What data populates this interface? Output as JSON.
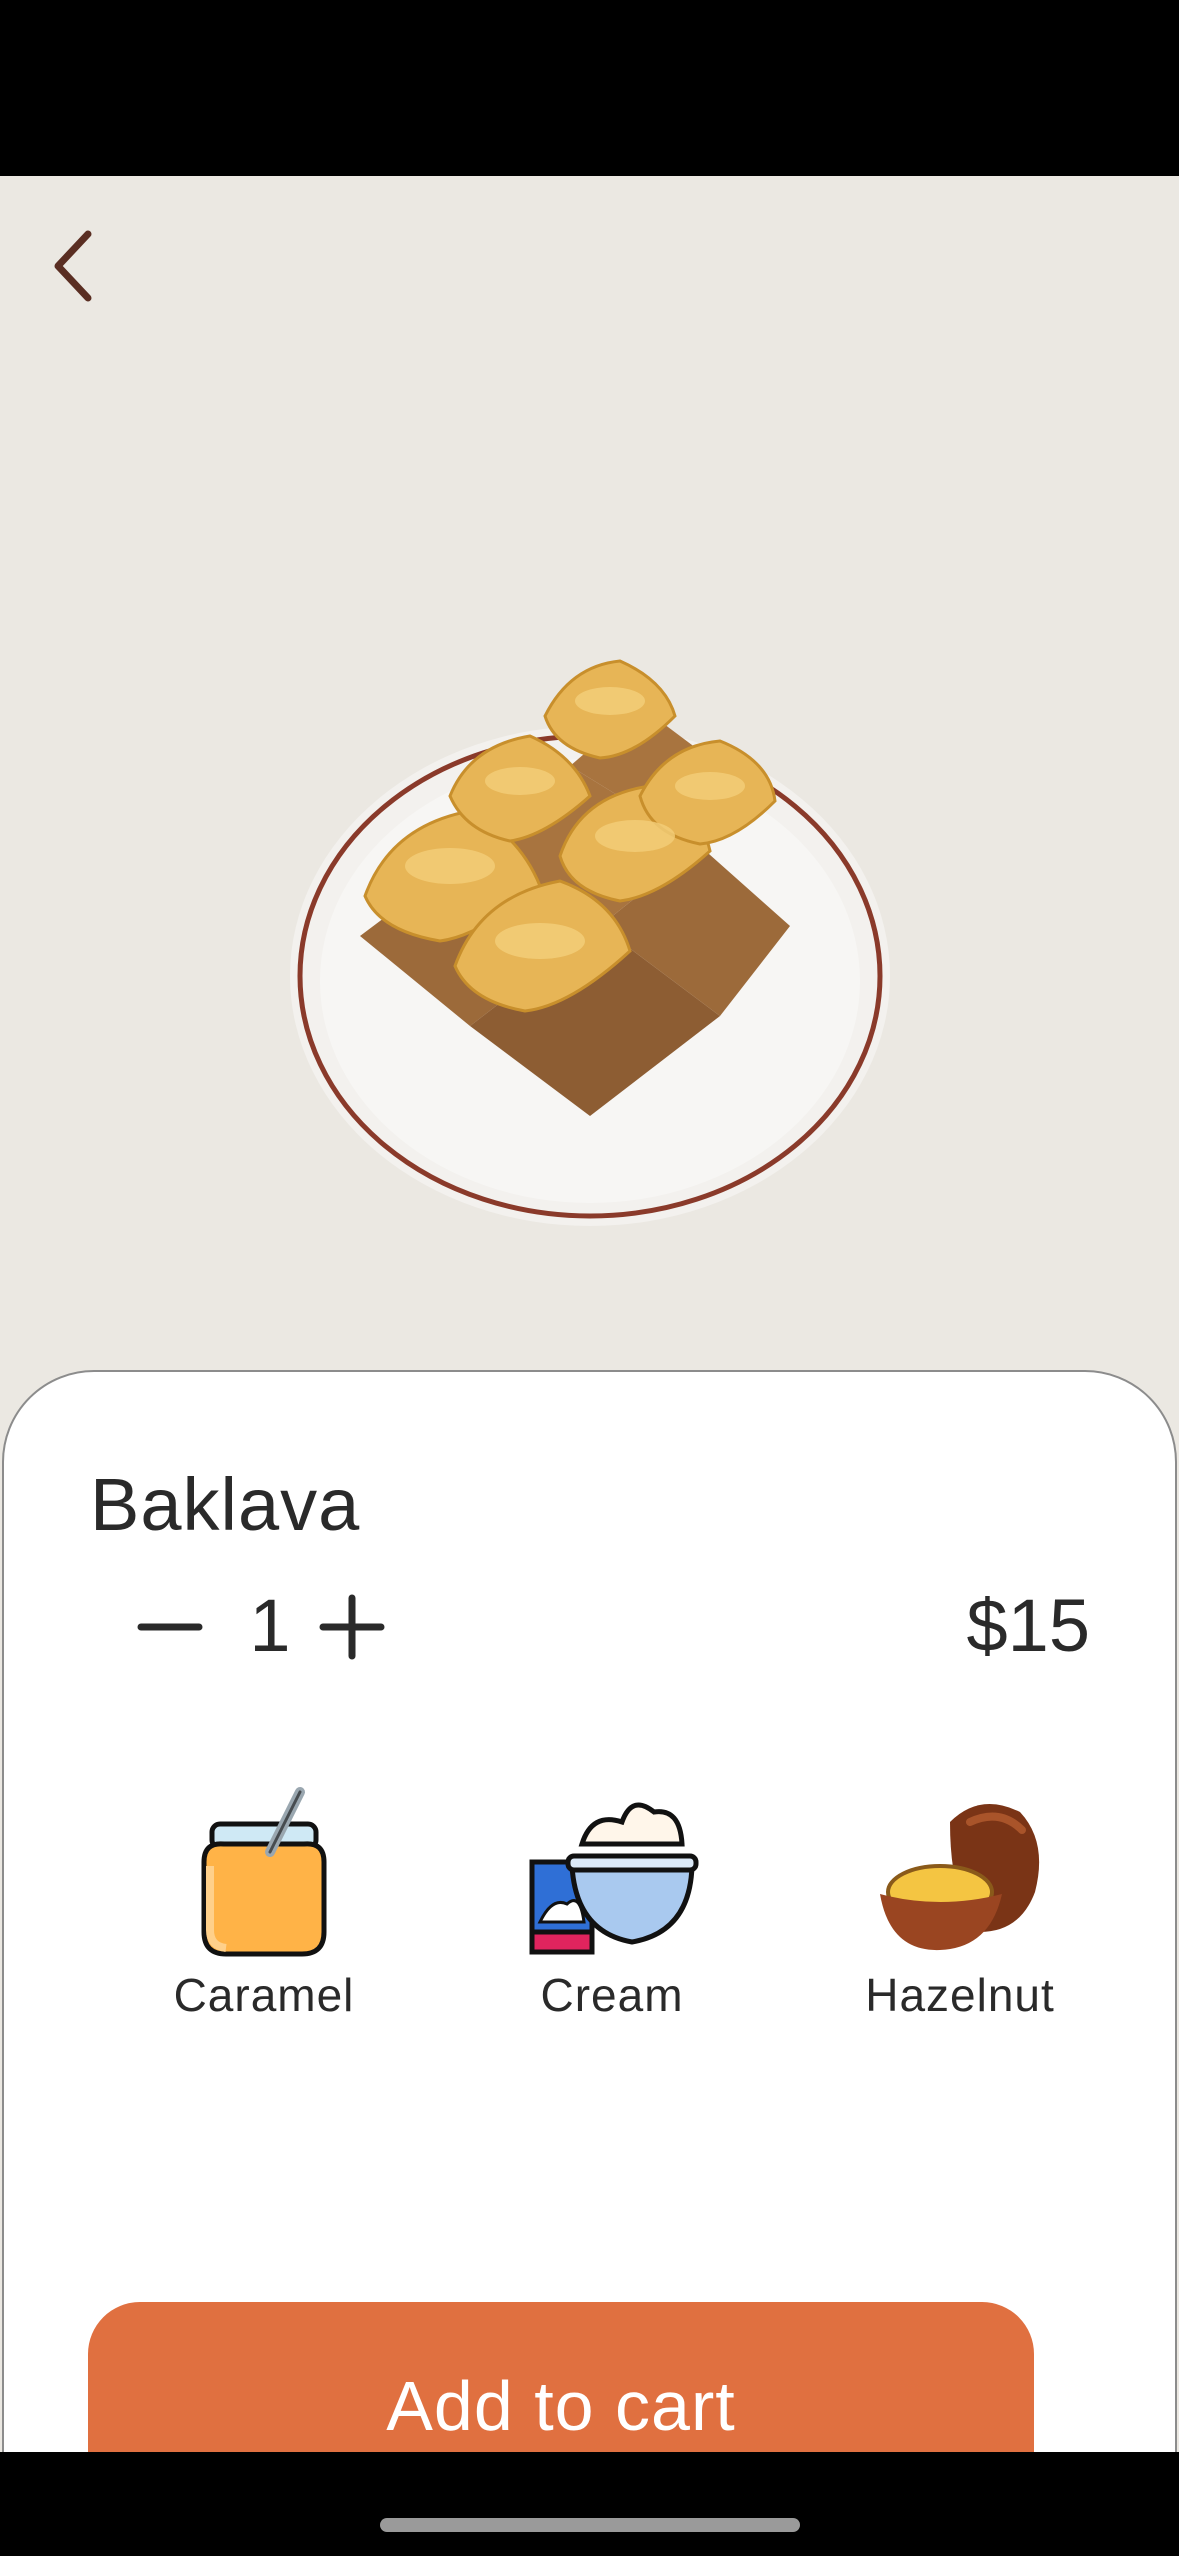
{
  "product": {
    "name": "Baklava",
    "quantity": "1",
    "price": "$15"
  },
  "toppings": [
    {
      "label": "Caramel",
      "icon": "honey-jar-icon"
    },
    {
      "label": "Cream",
      "icon": "whipped-cream-icon"
    },
    {
      "label": "Hazelnut",
      "icon": "hazelnut-icon"
    }
  ],
  "actions": {
    "add_to_cart": "Add to cart"
  },
  "colors": {
    "accent": "#e07040",
    "background": "#ebe8e2",
    "text": "#2a2a2a",
    "back_arrow": "#5a2e22"
  }
}
